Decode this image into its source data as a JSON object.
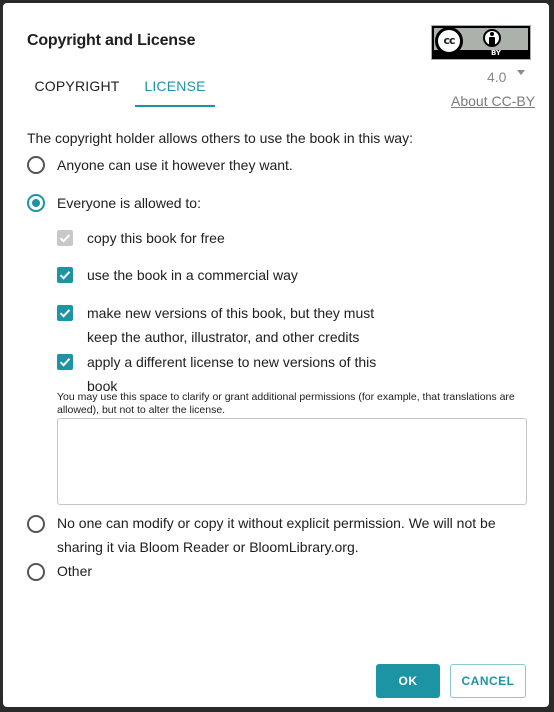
{
  "dialog": {
    "title": "Copyright and License",
    "tabs": [
      {
        "label": "COPYRIGHT",
        "active": false
      },
      {
        "label": "LICENSE",
        "active": true
      }
    ],
    "badge": {
      "cc_text": "cc",
      "by_text": "BY"
    },
    "version": "4.0",
    "about_link": "About CC-BY",
    "lead_text": "The copyright holder allows others to use the book in this way:",
    "options": {
      "anyone": "Anyone can use it however they want.",
      "everyone": "Everyone is allowed to:",
      "no_one_line1": "No one can modify or copy it without explicit permission. We will not be",
      "no_one_line2": "sharing it via Bloom Reader or BloomLibrary.org.",
      "other": "Other"
    },
    "permissions": {
      "copy": "copy this book for free",
      "commercial": "use the book in a commercial way",
      "derivatives_line1": "make new versions of this book, but they must",
      "derivatives_line2": "keep the author, illustrator, and other credits",
      "share_alike_line1": "apply a different license to new versions of this",
      "share_alike_line2": "book"
    },
    "hint": "You may use this space to clarify or grant additional permissions (for example, that translations are allowed), but not to alter the license.",
    "textarea_value": "",
    "buttons": {
      "ok": "OK",
      "cancel": "CANCEL"
    },
    "colors": {
      "accent": "#1d94a4",
      "disabled": "#c8c8c8"
    }
  }
}
